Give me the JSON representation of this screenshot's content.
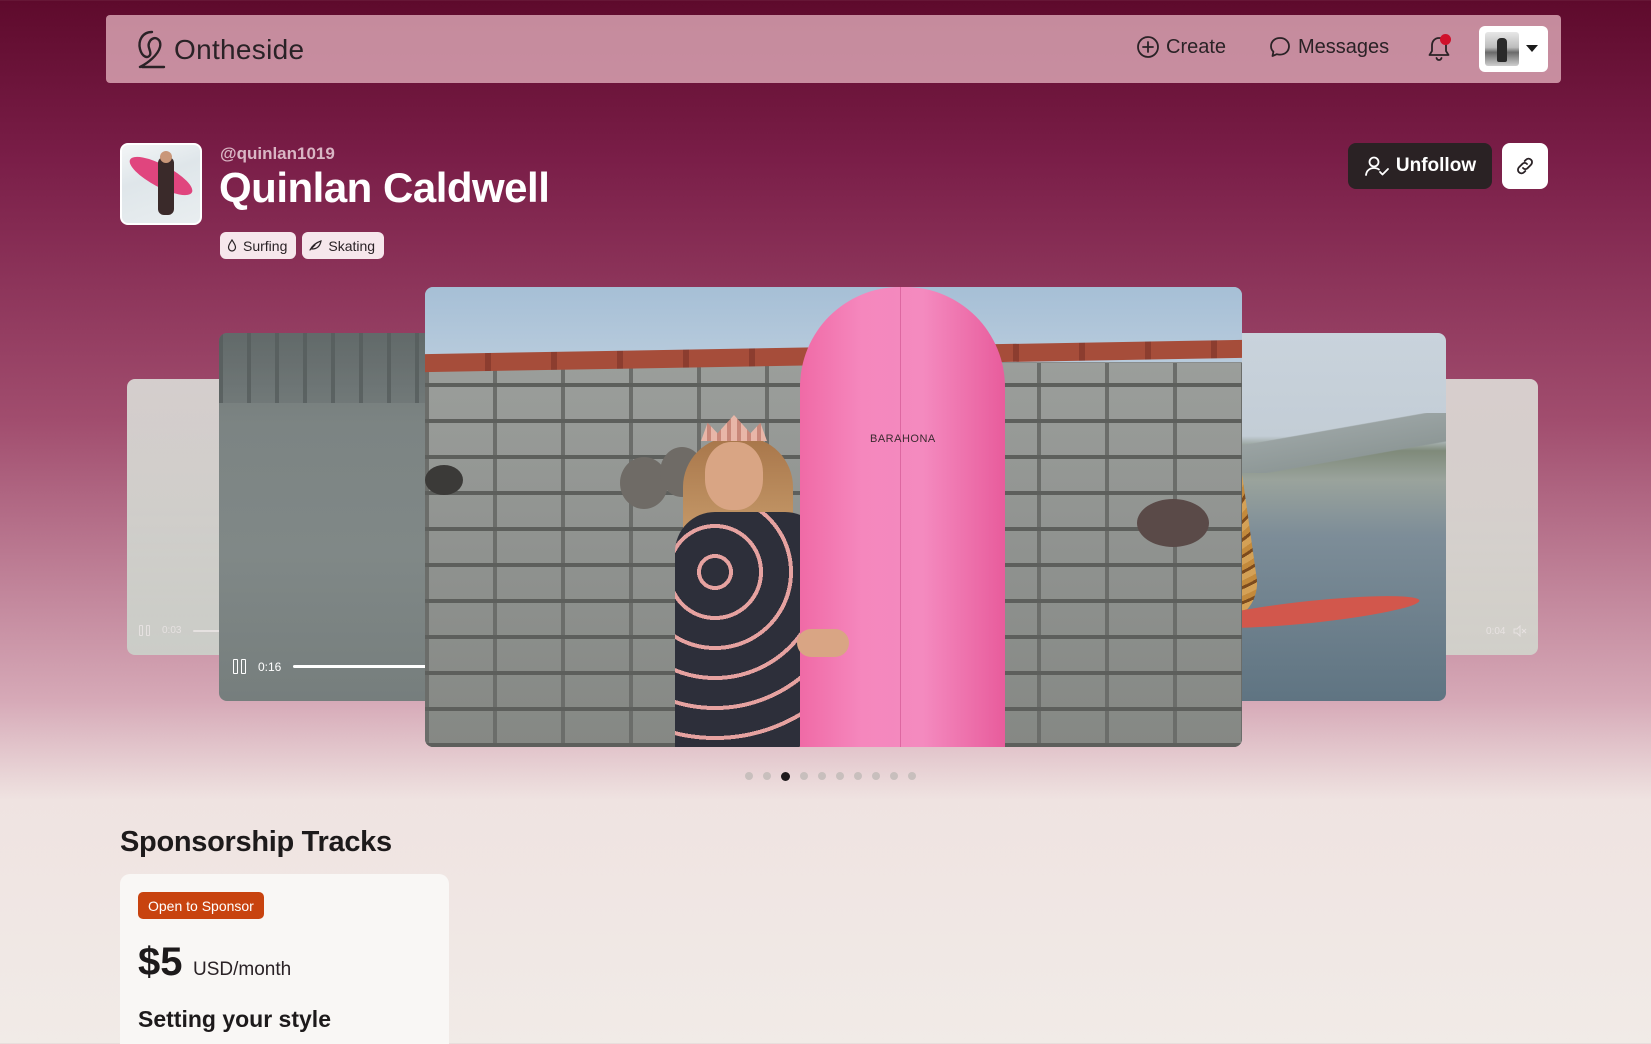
{
  "nav": {
    "logo_text": "Ontheside",
    "create_label": "Create",
    "messages_label": "Messages",
    "notification_dot_color": "#d0112b"
  },
  "profile": {
    "username": "@quinlan1019",
    "full_name": "Quinlan Caldwell",
    "tags": [
      {
        "label": "Surfing",
        "icon": "drop-icon"
      },
      {
        "label": "Skating",
        "icon": "leaf-icon"
      }
    ],
    "unfollow_label": "Unfollow"
  },
  "carousel": {
    "main_slide_brand": "BARAHONA",
    "left_video_time": "0:16",
    "far_left_video_time": "0:03",
    "far_right_video_time": "0:04",
    "dot_count": 10,
    "active_dot": 3
  },
  "sponsorship": {
    "section_title": "Sponsorship Tracks",
    "cards": [
      {
        "badge": "Open to Sponsor",
        "price": "$5",
        "unit": "USD/month",
        "title": "Setting your style"
      }
    ]
  },
  "colors": {
    "gradient_top": "#5e0a2c",
    "badge_orange": "#c8430f",
    "unfollow_bg": "#2a2224"
  }
}
